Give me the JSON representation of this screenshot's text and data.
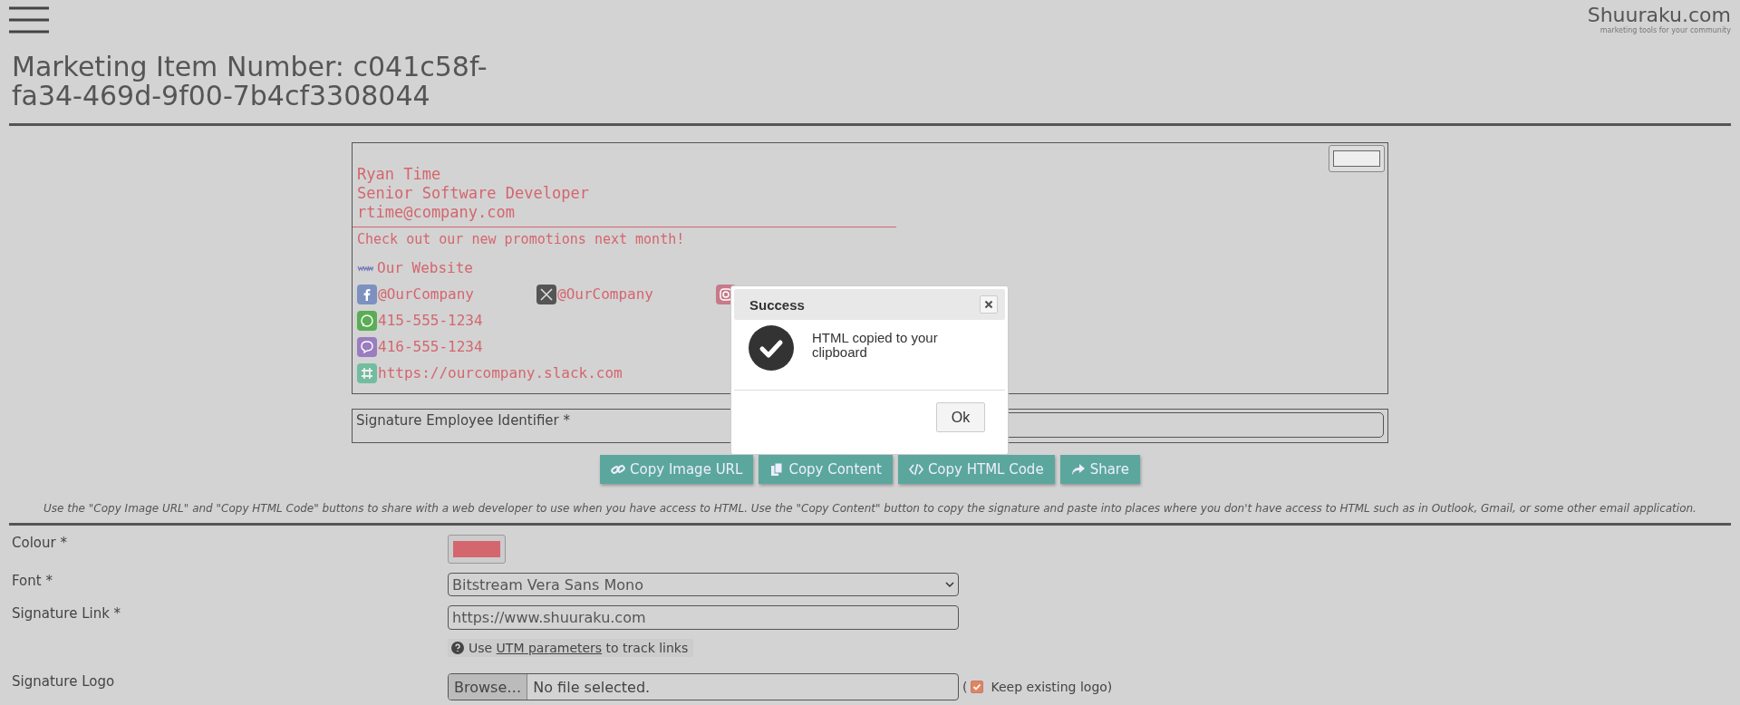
{
  "header": {
    "logo": "Shuuraku.com",
    "tagline": "marketing tools for your community"
  },
  "title": "Marketing Item Number: c041c58f-fa34-469d-9f00-7b4cf3308044",
  "signature": {
    "name": "Ryan Time",
    "job": "Senior Software Developer",
    "email": "rtime@company.com",
    "promo": "Check out our new promotions next month!",
    "rows": [
      [
        {
          "kind": "www",
          "text": "Our Website"
        }
      ],
      [
        {
          "kind": "facebook",
          "text": "@OurCompany"
        },
        {
          "kind": "x",
          "text": "@OurCompany"
        },
        {
          "kind": "instagram"
        }
      ],
      [
        {
          "kind": "whatsapp",
          "text": "415-555-1234"
        }
      ],
      [
        {
          "kind": "viber",
          "text": "416-555-1234"
        }
      ],
      [
        {
          "kind": "slack",
          "text": "https://ourcompany.slack.com"
        }
      ]
    ]
  },
  "identifier": {
    "label": "Signature Employee Identifier *"
  },
  "actions": [
    {
      "kind": "link",
      "label": "Copy Image URL"
    },
    {
      "kind": "copy",
      "label": "Copy Content"
    },
    {
      "kind": "code",
      "label": "Copy HTML Code"
    },
    {
      "kind": "share",
      "label": "Share"
    }
  ],
  "instructions": "Use the \"Copy Image URL\" and \"Copy HTML Code\" buttons to share with a web developer to use when you have access to HTML. Use the \"Copy Content\" button to copy the signature and paste into places where you don't have access to HTML such as in Outlook, Gmail, or some other email application.",
  "fields": [
    {
      "kind": "color",
      "label": "Colour *",
      "color": "#d4666e"
    },
    {
      "kind": "select",
      "label": "Font *",
      "value": "Bitstream Vera Sans Mono"
    },
    {
      "kind": "text",
      "label": "Signature Link *",
      "value": "https://www.shuuraku.com",
      "help": {
        "before": "Use",
        "link": "UTM parameters",
        "after": "to track links"
      }
    },
    {
      "kind": "file",
      "label": "Signature Logo",
      "browse": "Browse…",
      "status": "No file selected.",
      "paren": "(",
      "checkbox": {
        "label": "Keep existing logo)",
        "checked": true
      }
    }
  ],
  "dialog": {
    "title": "Success",
    "message": "HTML copied to your clipboard",
    "ok": "Ok"
  }
}
